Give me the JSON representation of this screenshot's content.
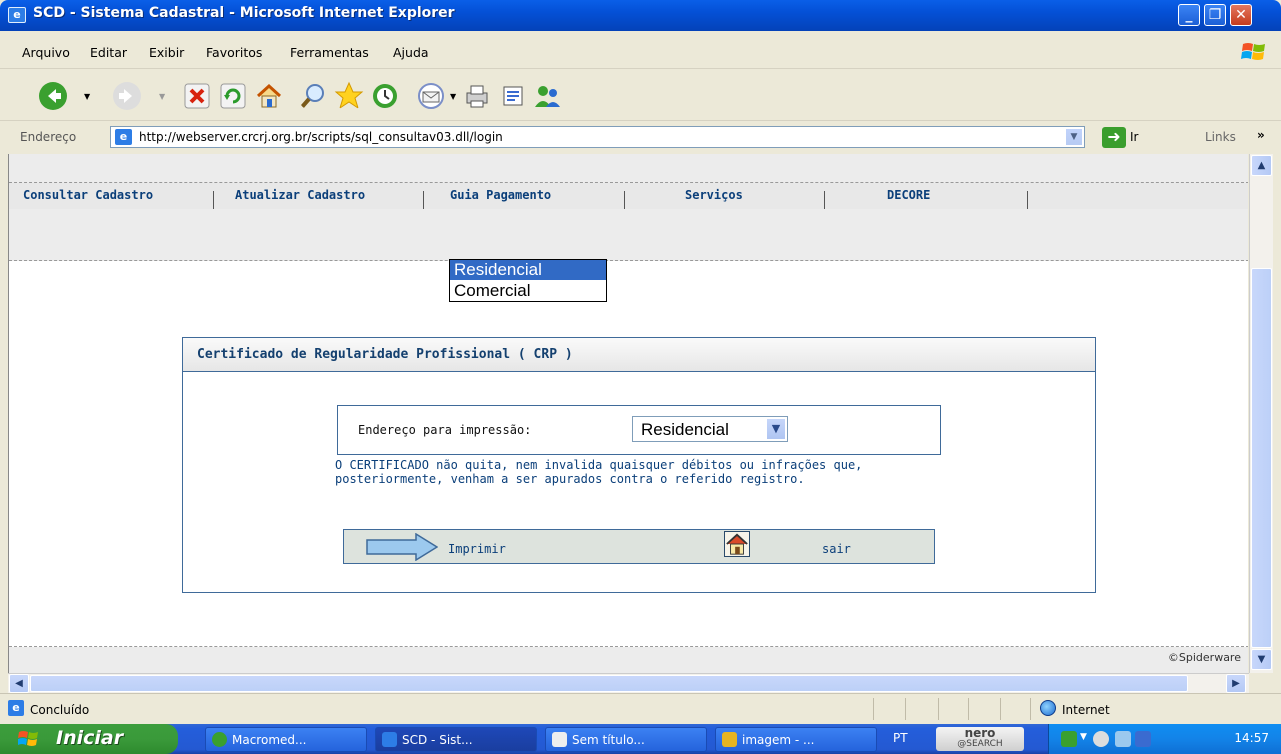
{
  "window": {
    "title": "SCD - Sistema Cadastral - Microsoft Internet Explorer"
  },
  "menu": [
    "Arquivo",
    "Editar",
    "Exibir",
    "Favoritos",
    "Ferramentas",
    "Ajuda"
  ],
  "address": {
    "label": "Endereço",
    "url": "http://webserver.crcrj.org.br/scripts/sql_consultav03.dll/login",
    "go": "Ir",
    "links": "Links"
  },
  "nav": [
    "Consultar Cadastro",
    "Atualizar Cadastro",
    "Guia Pagamento",
    "Serviços",
    "DECORE"
  ],
  "crp": {
    "title": "Certificado de Regularidade Profissional ( CRP )",
    "address_label": "Endereço para impressão:",
    "selected": "Residencial",
    "options": [
      "Residencial",
      "Comercial"
    ],
    "notice": "O CERTIFICADO não quita, nem invalida quaisquer débitos ou infrações que, posteriormente, venham a ser apurados contra o referido registro.",
    "print_label": "Imprimir",
    "exit_label": "sair"
  },
  "footer": {
    "credit": "©Spiderware"
  },
  "status": {
    "text": "Concluído",
    "zone": "Internet"
  },
  "taskbar": {
    "start": "Iniciar",
    "items": [
      "Macromed...",
      "SCD - Sist...",
      "Sem título...",
      "imagem - ..."
    ],
    "lang": "PT",
    "nero_top": "nero",
    "nero_bottom": "@SEARCH",
    "clock": "14:57"
  },
  "colors": {
    "titlebar": "#0450d6",
    "link": "#0b3f7a",
    "selection": "#316ac5",
    "taskbar": "#245edb",
    "start": "#3a9a3a"
  }
}
